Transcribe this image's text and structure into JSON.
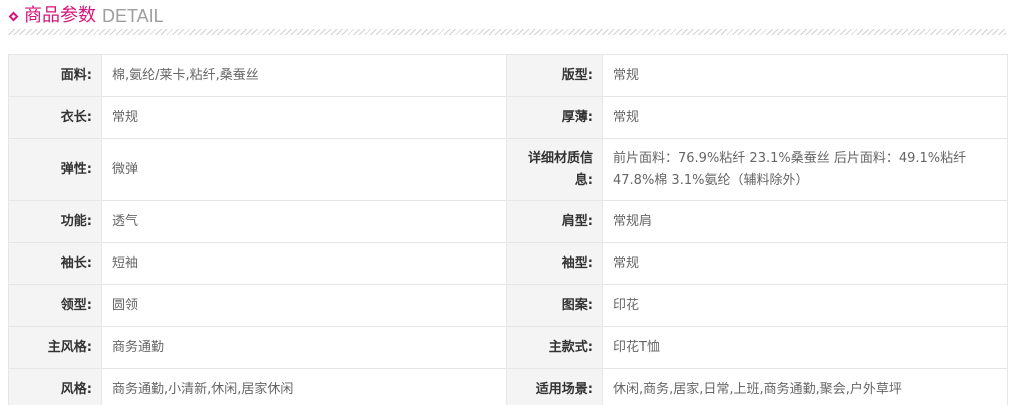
{
  "header": {
    "title_cn": "商品参数",
    "title_en": "DETAIL",
    "accent_color": "#d6157a",
    "icon": "diamond-icon"
  },
  "params": [
    {
      "left_label": "面料:",
      "left_value": "棉,氨纶/莱卡,粘纤,桑蚕丝",
      "right_label": "版型:",
      "right_value": "常规"
    },
    {
      "left_label": "衣长:",
      "left_value": "常规",
      "right_label": "厚薄:",
      "right_value": "常规"
    },
    {
      "left_label": "弹性:",
      "left_value": "微弹",
      "right_label": "详细材质信息:",
      "right_value": "前片面料：76.9%粘纤 23.1%桑蚕丝 后片面料：49.1%粘纤 47.8%棉 3.1%氨纶（辅料除外）"
    },
    {
      "left_label": "功能:",
      "left_value": "透气",
      "right_label": "肩型:",
      "right_value": "常规肩"
    },
    {
      "left_label": "袖长:",
      "left_value": "短袖",
      "right_label": "袖型:",
      "right_value": "常规"
    },
    {
      "left_label": "领型:",
      "left_value": "圆领",
      "right_label": "图案:",
      "right_value": "印花"
    },
    {
      "left_label": "主风格:",
      "left_value": "商务通勤",
      "right_label": "主款式:",
      "right_value": "印花T恤"
    },
    {
      "left_label": "风格:",
      "left_value": "商务通勤,小清新,休闲,居家休闲",
      "right_label": "适用场景:",
      "right_value": "休闲,商务,居家,日常,上班,商务通勤,聚会,户外草坪"
    }
  ]
}
